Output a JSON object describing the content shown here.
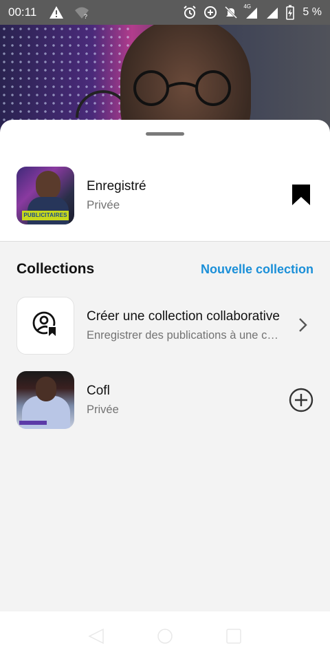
{
  "status_bar": {
    "time": "00:11",
    "network_type": "4G",
    "battery_percent": "5 %",
    "icons": [
      "alert-icon",
      "wifi-question-icon",
      "alarm-icon",
      "data-saver-icon",
      "bell-off-icon",
      "signal-icon",
      "signal-icon",
      "battery-charging-icon"
    ]
  },
  "saved": {
    "title": "Enregistré",
    "privacy": "Privée",
    "thumbnail_banner": "PUBLICITAIRES",
    "icon": "bookmark-filled-icon"
  },
  "collections": {
    "heading": "Collections",
    "new_collection_label": "Nouvelle collection",
    "accent_color": "#1a8fd8",
    "items": [
      {
        "title": "Créer une collection collaborative",
        "subtitle": "Enregistrer des publications à une collection partagée",
        "icon": "collab-user-bookmark-icon",
        "action_icon": "chevron-right-icon"
      },
      {
        "title": "Cofl",
        "subtitle": "Privée",
        "icon": "collection-thumbnail",
        "action_icon": "plus-circle-icon"
      }
    ]
  },
  "nav_bar": {
    "icons": [
      "back-icon",
      "home-icon",
      "recents-icon"
    ]
  }
}
